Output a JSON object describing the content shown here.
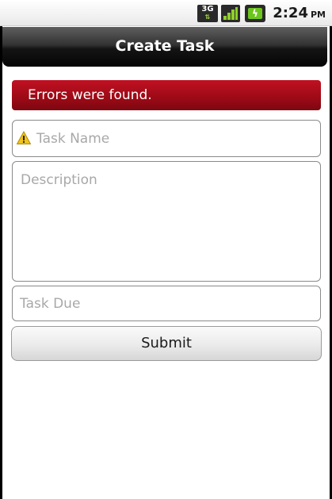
{
  "status_bar": {
    "network_label": "3G",
    "network_arrows": "⇅",
    "time": "2:24",
    "ampm": "PM",
    "icons": [
      "3g-data-icon",
      "signal-strength-icon",
      "battery-charging-icon"
    ]
  },
  "title_bar": {
    "title": "Create Task"
  },
  "error_banner": {
    "message": "Errors were found.",
    "color": "#a00c18"
  },
  "form": {
    "task_name": {
      "value": "",
      "placeholder": "Task Name",
      "error_icon": "warning-icon"
    },
    "description": {
      "value": "",
      "placeholder": "Description"
    },
    "task_due": {
      "value": "",
      "placeholder": "Task Due"
    },
    "submit_label": "Submit"
  }
}
